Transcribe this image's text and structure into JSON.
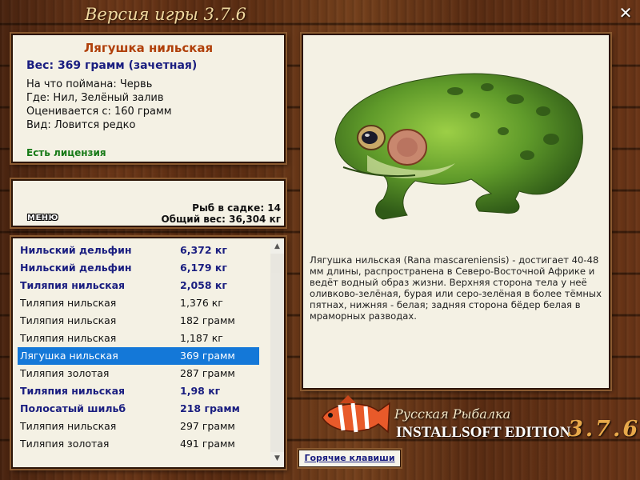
{
  "header": {
    "game_version": "Версия игры 3.7.6"
  },
  "fish_info": {
    "name": "Лягушка нильская",
    "weight": "Вес: 369 грамм (зачетная)",
    "bait": "На что поймана: Червь",
    "location": "Где: Нил, Зелёный залив",
    "scored_from": "Оценивается с: 160 грамм",
    "rarity": "Вид: Ловится редко",
    "license": "Есть лицензия"
  },
  "keep": {
    "menu_label": "МЕНЮ",
    "fish_count": "Рыб в садке: 14",
    "total_weight": "Общий вес: 36,304 кг"
  },
  "catch_list": [
    {
      "name": "Нильский дельфин",
      "weight": "6,372 кг",
      "bold": true
    },
    {
      "name": "Нильский дельфин",
      "weight": "6,179 кг",
      "bold": true
    },
    {
      "name": "Тиляпия нильская",
      "weight": "2,058 кг",
      "bold": true
    },
    {
      "name": "Тиляпия нильская",
      "weight": "1,376 кг",
      "bold": false
    },
    {
      "name": "Тиляпия нильская",
      "weight": "182 грамм",
      "bold": false
    },
    {
      "name": "Тиляпия нильская",
      "weight": "1,187 кг",
      "bold": false
    },
    {
      "name": "Лягушка нильская",
      "weight": "369 грамм",
      "bold": true,
      "selected": true
    },
    {
      "name": "Тиляпия золотая",
      "weight": "287 грамм",
      "bold": false
    },
    {
      "name": "Тиляпия нильская",
      "weight": "1,98 кг",
      "bold": true
    },
    {
      "name": "Полосатый шильб",
      "weight": "218 грамм",
      "bold": true
    },
    {
      "name": "Тиляпия нильская",
      "weight": "297 грамм",
      "bold": false
    },
    {
      "name": "Тиляпия золотая",
      "weight": "491 грамм",
      "bold": false
    }
  ],
  "detail": {
    "description": "Лягушка нильская (Rana mascareniensis) - достигает 40-48 мм длины, распространена в Северо-Восточной Африке и ведёт водный образ жизни. Верхняя сторона тела у неё оливково-зелёная, бурая или серо-зелёная в более тёмных пятнах, нижняя - белая; задняя сторона бёдер белая в мраморных разводах."
  },
  "brand": {
    "name": "Русская Рыбалка",
    "edition": "INSTALLSOFT EDITION",
    "version": "3.7.6"
  },
  "hotkeys_label": "Горячие клавиши",
  "colors": {
    "fish_name": "#b0400a",
    "weight_text": "#1a1e80",
    "license": "#177a17",
    "selection": "#1478d8",
    "panel_bg": "#f4f1e4"
  },
  "icons": {
    "close": "close-icon",
    "scroll_up": "arrow-up-icon",
    "scroll_down": "arrow-down-icon"
  }
}
